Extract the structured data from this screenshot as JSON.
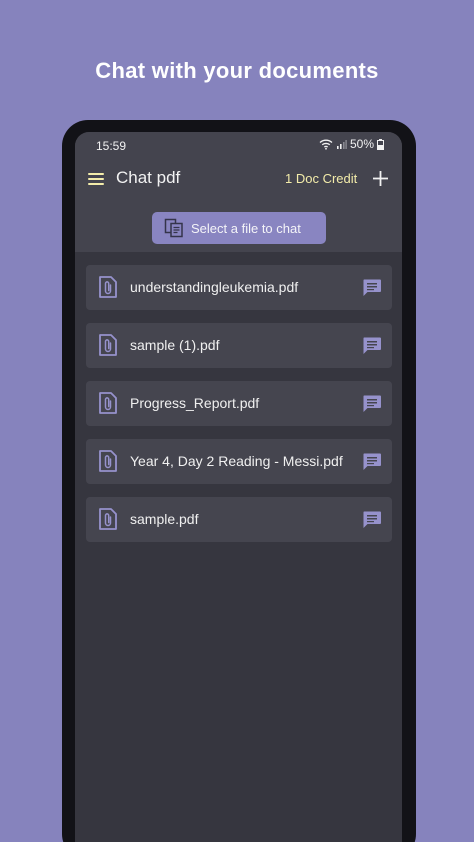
{
  "promo": {
    "title": "Chat with your documents"
  },
  "status_bar": {
    "time": "15:59",
    "battery": "50%"
  },
  "app_bar": {
    "title": "Chat pdf",
    "credit": "1 Doc Credit",
    "menu_icon": "hamburger-menu-icon",
    "add_icon": "plus-icon"
  },
  "select_button": {
    "label": "Select a file to chat",
    "icon": "file-copy-icon"
  },
  "files": [
    {
      "name": "understandingleukemia.pdf"
    },
    {
      "name": "sample (1).pdf"
    },
    {
      "name": "Progress_Report.pdf"
    },
    {
      "name": "Year 4, Day 2 Reading - Messi.pdf"
    },
    {
      "name": "sample.pdf"
    }
  ],
  "colors": {
    "background": "#8683bd",
    "accent": "#8985c1",
    "credit": "#f3ecaa",
    "surface": "#36363f",
    "card": "#45454f"
  }
}
